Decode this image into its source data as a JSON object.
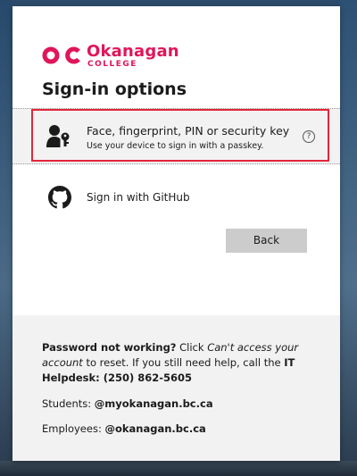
{
  "logo": {
    "mark": "OC",
    "name": "Okanagan",
    "sub": "COLLEGE",
    "brand_color": "#e0155a"
  },
  "title": "Sign-in options",
  "options": [
    {
      "icon": "passkey-user-key-icon",
      "title": "Face, fingerprint, PIN or security key",
      "subtitle": "Use your device to sign in with a passkey.",
      "help_icon": "question-circle-icon",
      "help_glyph": "?"
    },
    {
      "icon": "github-icon",
      "title": "Sign in with GitHub"
    }
  ],
  "back_label": "Back",
  "footer": {
    "help_bold": "Password not working?",
    "help_p1": " Click ",
    "help_italic": "Can't access your account",
    "help_p2": " to reset. If you still need help, call the ",
    "help_bold2": "IT Helpdesk: (250) 862-5605",
    "students_label": "Students: ",
    "students_domain": "@myokanagan.bc.ca",
    "employees_label": "Employees: ",
    "employees_domain": "@okanagan.bc.ca"
  },
  "colors": {
    "highlight": "#e2263a",
    "button": "#cccccc",
    "footer_bg": "#f2f2f2"
  }
}
